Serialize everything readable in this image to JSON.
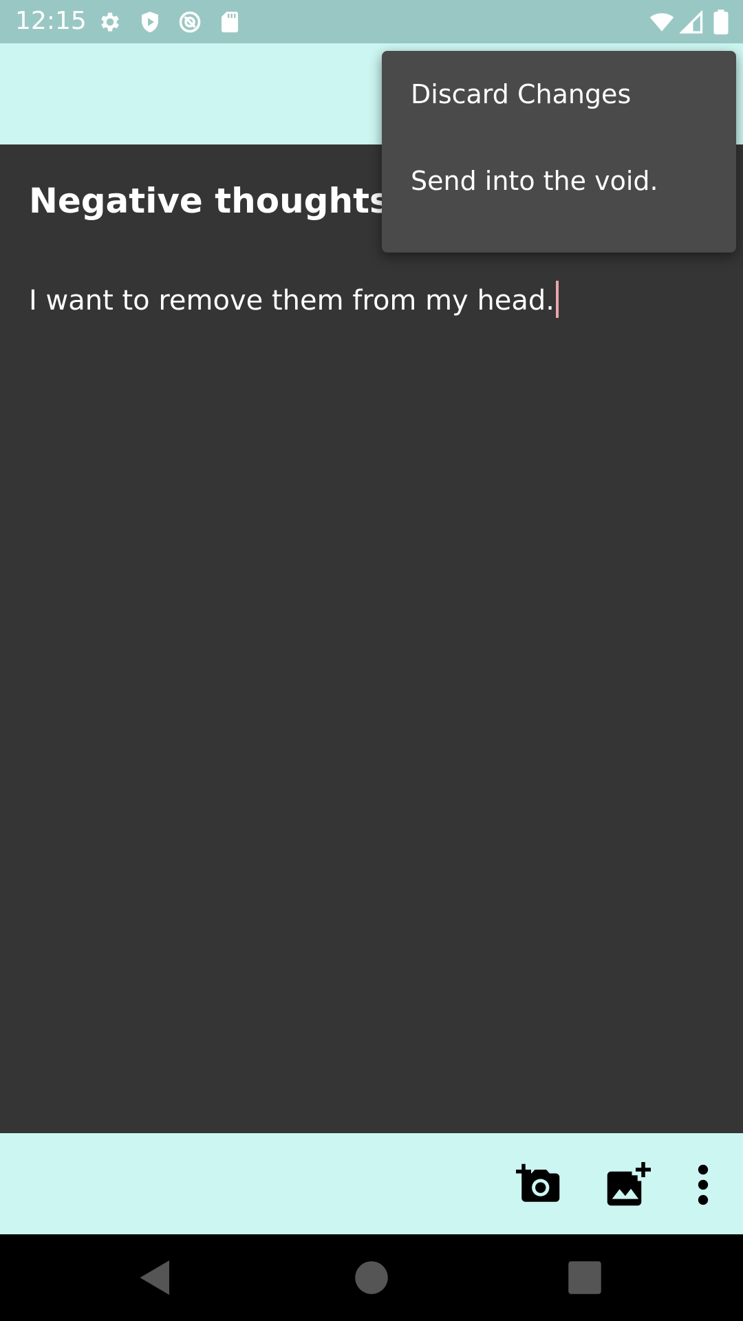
{
  "status_bar": {
    "time": "12:15",
    "background": "#99c8c4",
    "left_icons": [
      "gear-icon",
      "shield-play-icon",
      "at-sign-icon",
      "sd-card-icon"
    ],
    "right_icons": [
      "wifi-icon",
      "signal-icon",
      "battery-icon"
    ]
  },
  "top_bar": {
    "background": "#ccf6f2"
  },
  "note": {
    "title": "Negative thoughts",
    "body": "I want to remove them from my head.",
    "background": "#353535",
    "caret_color": "#e9a6ad"
  },
  "menu": {
    "background": "#4a4a4a",
    "items": [
      {
        "label": "Discard Changes"
      },
      {
        "label": "Send into the void."
      }
    ]
  },
  "bottom_bar": {
    "background": "#ccf6f2",
    "icons": [
      "add-camera-icon",
      "add-image-icon",
      "more-vert-icon"
    ]
  },
  "nav_bar": {
    "icons": [
      "back-triangle-icon",
      "home-circle-icon",
      "recents-square-icon"
    ]
  }
}
